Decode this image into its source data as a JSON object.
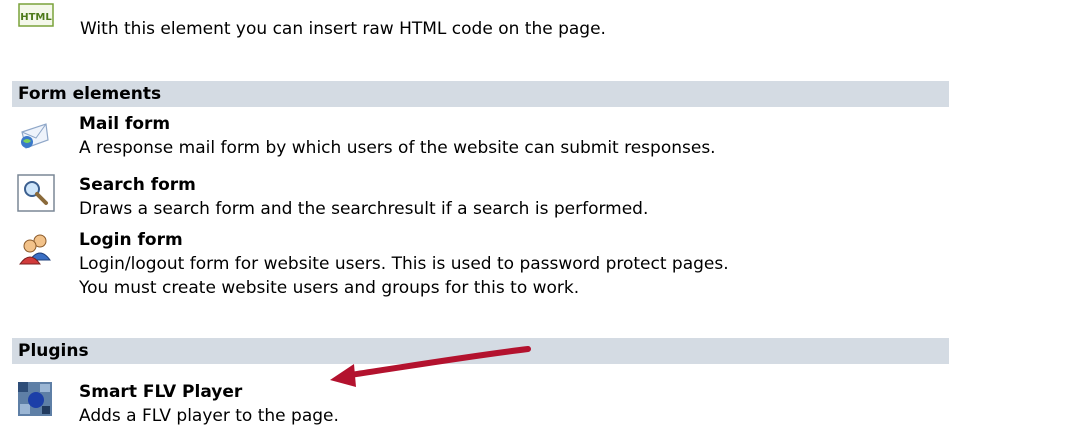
{
  "html_element": {
    "icon_label": "HTML",
    "description": "With this element you can insert raw HTML code on the page."
  },
  "form_elements": {
    "header": "Form elements",
    "items": [
      {
        "title": "Mail form",
        "description": "A response mail form by which users of the website can submit responses."
      },
      {
        "title": "Search form",
        "description": "Draws a search form and the searchresult if a search is performed."
      },
      {
        "title": "Login form",
        "description_line1": "Login/logout form for website users. This is used to password protect pages.",
        "description_line2": "You must create website users and groups for this to work."
      }
    ]
  },
  "plugins": {
    "header": "Plugins",
    "items": [
      {
        "title": "Smart FLV Player",
        "description": "Adds a FLV player to the page."
      }
    ]
  },
  "colors": {
    "section_header_bg": "#d4dbe3",
    "arrow": "#b3122e"
  }
}
